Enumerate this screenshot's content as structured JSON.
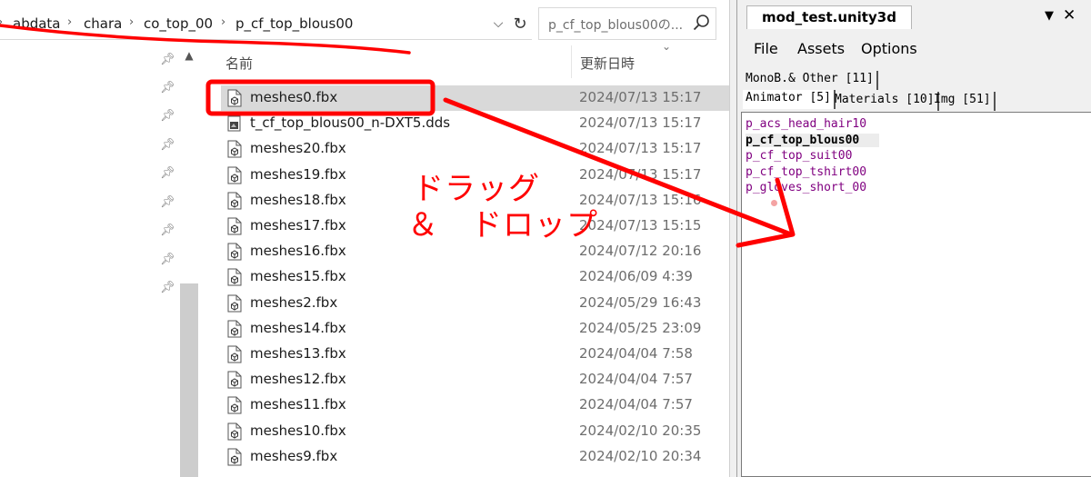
{
  "explorer": {
    "breadcrumbs": [
      "abdata",
      "chara",
      "co_top_00",
      "p_cf_top_blous00"
    ],
    "search_placeholder": "p_cf_top_blous00の...",
    "columns": {
      "name": "名前",
      "date": "更新日時"
    },
    "files": [
      {
        "name": "meshes0.fbx",
        "date": "2024/07/13 15:17",
        "type": "fbx",
        "selected": true
      },
      {
        "name": "t_cf_top_blous00_n-DXT5.dds",
        "date": "2024/07/13 15:17",
        "type": "dds"
      },
      {
        "name": "meshes20.fbx",
        "date": "2024/07/13 15:17",
        "type": "fbx"
      },
      {
        "name": "meshes19.fbx",
        "date": "2024/07/13 15:17",
        "type": "fbx"
      },
      {
        "name": "meshes18.fbx",
        "date": "2024/07/13 15:16",
        "type": "fbx"
      },
      {
        "name": "meshes17.fbx",
        "date": "2024/07/13 15:15",
        "type": "fbx"
      },
      {
        "name": "meshes16.fbx",
        "date": "2024/07/12 20:16",
        "type": "fbx"
      },
      {
        "name": "meshes15.fbx",
        "date": "2024/06/09 4:39",
        "type": "fbx"
      },
      {
        "name": "meshes2.fbx",
        "date": "2024/05/29 16:43",
        "type": "fbx"
      },
      {
        "name": "meshes14.fbx",
        "date": "2024/05/25 23:09",
        "type": "fbx"
      },
      {
        "name": "meshes13.fbx",
        "date": "2024/04/04 7:58",
        "type": "fbx"
      },
      {
        "name": "meshes12.fbx",
        "date": "2024/04/04 7:57",
        "type": "fbx"
      },
      {
        "name": "meshes11.fbx",
        "date": "2024/04/04 7:57",
        "type": "fbx"
      },
      {
        "name": "meshes10.fbx",
        "date": "2024/02/10 20:35",
        "type": "fbx"
      },
      {
        "name": "meshes9.fbx",
        "date": "2024/02/10 20:34",
        "type": "fbx"
      }
    ]
  },
  "tool": {
    "title": "mod_test.unity3d",
    "menu": [
      "File",
      "Assets",
      "Options"
    ],
    "tabs_row1": [
      "MonoB.& Other [11]"
    ],
    "tabs_row2": [
      "Animator [5]",
      "Materials [10]",
      "Img [51]"
    ],
    "active_tab": "Animator [5]",
    "assets": [
      {
        "name": "p_acs_head_hair10",
        "selected": false
      },
      {
        "name": "p_cf_top_blous00",
        "selected": true
      },
      {
        "name": "p_cf_top_suit00",
        "selected": false
      },
      {
        "name": "p_cf_top_tshirt00",
        "selected": false
      },
      {
        "name": "p_gloves_short_00",
        "selected": false
      }
    ]
  },
  "annotation": {
    "line1": "ドラッグ",
    "line2": "＆　ドロップ",
    "color": "#ff0000"
  }
}
